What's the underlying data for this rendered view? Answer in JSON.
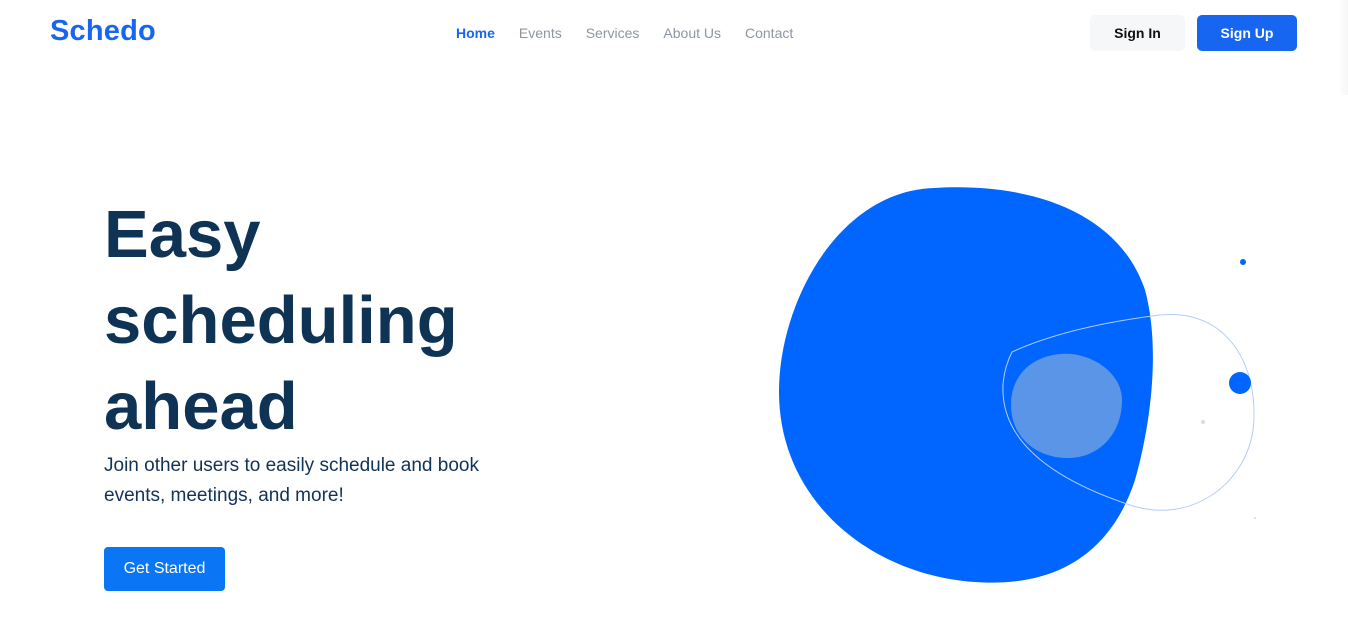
{
  "header": {
    "logo": "Schedo",
    "nav": [
      "Home",
      "Events",
      "Services",
      "About Us",
      "Contact"
    ],
    "active_nav": "Home",
    "sign_in": "Sign In",
    "sign_up": "Sign Up"
  },
  "hero": {
    "title_lines": [
      "Easy",
      "scheduling",
      "ahead"
    ],
    "subtitle": "Join other users to easily schedule and book events, meetings, and more!",
    "cta": "Get Started"
  },
  "colors": {
    "brand": "#1766f2",
    "heading": "#0f3354",
    "blob": "#0066ff",
    "blob_inner": "#5b95e8",
    "nav_inactive": "#8d95a3"
  }
}
